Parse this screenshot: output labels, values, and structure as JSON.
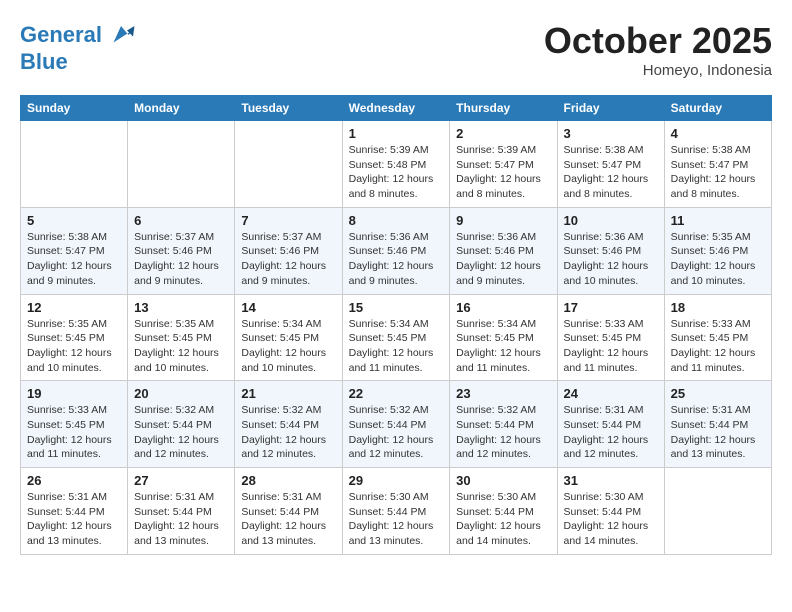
{
  "logo": {
    "line1": "General",
    "line2": "Blue"
  },
  "title": "October 2025",
  "subtitle": "Homeyo, Indonesia",
  "weekdays": [
    "Sunday",
    "Monday",
    "Tuesday",
    "Wednesday",
    "Thursday",
    "Friday",
    "Saturday"
  ],
  "weeks": [
    [
      {
        "day": "",
        "info": ""
      },
      {
        "day": "",
        "info": ""
      },
      {
        "day": "",
        "info": ""
      },
      {
        "day": "1",
        "info": "Sunrise: 5:39 AM\nSunset: 5:48 PM\nDaylight: 12 hours\nand 8 minutes."
      },
      {
        "day": "2",
        "info": "Sunrise: 5:39 AM\nSunset: 5:47 PM\nDaylight: 12 hours\nand 8 minutes."
      },
      {
        "day": "3",
        "info": "Sunrise: 5:38 AM\nSunset: 5:47 PM\nDaylight: 12 hours\nand 8 minutes."
      },
      {
        "day": "4",
        "info": "Sunrise: 5:38 AM\nSunset: 5:47 PM\nDaylight: 12 hours\nand 8 minutes."
      }
    ],
    [
      {
        "day": "5",
        "info": "Sunrise: 5:38 AM\nSunset: 5:47 PM\nDaylight: 12 hours\nand 9 minutes."
      },
      {
        "day": "6",
        "info": "Sunrise: 5:37 AM\nSunset: 5:46 PM\nDaylight: 12 hours\nand 9 minutes."
      },
      {
        "day": "7",
        "info": "Sunrise: 5:37 AM\nSunset: 5:46 PM\nDaylight: 12 hours\nand 9 minutes."
      },
      {
        "day": "8",
        "info": "Sunrise: 5:36 AM\nSunset: 5:46 PM\nDaylight: 12 hours\nand 9 minutes."
      },
      {
        "day": "9",
        "info": "Sunrise: 5:36 AM\nSunset: 5:46 PM\nDaylight: 12 hours\nand 9 minutes."
      },
      {
        "day": "10",
        "info": "Sunrise: 5:36 AM\nSunset: 5:46 PM\nDaylight: 12 hours\nand 10 minutes."
      },
      {
        "day": "11",
        "info": "Sunrise: 5:35 AM\nSunset: 5:46 PM\nDaylight: 12 hours\nand 10 minutes."
      }
    ],
    [
      {
        "day": "12",
        "info": "Sunrise: 5:35 AM\nSunset: 5:45 PM\nDaylight: 12 hours\nand 10 minutes."
      },
      {
        "day": "13",
        "info": "Sunrise: 5:35 AM\nSunset: 5:45 PM\nDaylight: 12 hours\nand 10 minutes."
      },
      {
        "day": "14",
        "info": "Sunrise: 5:34 AM\nSunset: 5:45 PM\nDaylight: 12 hours\nand 10 minutes."
      },
      {
        "day": "15",
        "info": "Sunrise: 5:34 AM\nSunset: 5:45 PM\nDaylight: 12 hours\nand 11 minutes."
      },
      {
        "day": "16",
        "info": "Sunrise: 5:34 AM\nSunset: 5:45 PM\nDaylight: 12 hours\nand 11 minutes."
      },
      {
        "day": "17",
        "info": "Sunrise: 5:33 AM\nSunset: 5:45 PM\nDaylight: 12 hours\nand 11 minutes."
      },
      {
        "day": "18",
        "info": "Sunrise: 5:33 AM\nSunset: 5:45 PM\nDaylight: 12 hours\nand 11 minutes."
      }
    ],
    [
      {
        "day": "19",
        "info": "Sunrise: 5:33 AM\nSunset: 5:45 PM\nDaylight: 12 hours\nand 11 minutes."
      },
      {
        "day": "20",
        "info": "Sunrise: 5:32 AM\nSunset: 5:44 PM\nDaylight: 12 hours\nand 12 minutes."
      },
      {
        "day": "21",
        "info": "Sunrise: 5:32 AM\nSunset: 5:44 PM\nDaylight: 12 hours\nand 12 minutes."
      },
      {
        "day": "22",
        "info": "Sunrise: 5:32 AM\nSunset: 5:44 PM\nDaylight: 12 hours\nand 12 minutes."
      },
      {
        "day": "23",
        "info": "Sunrise: 5:32 AM\nSunset: 5:44 PM\nDaylight: 12 hours\nand 12 minutes."
      },
      {
        "day": "24",
        "info": "Sunrise: 5:31 AM\nSunset: 5:44 PM\nDaylight: 12 hours\nand 12 minutes."
      },
      {
        "day": "25",
        "info": "Sunrise: 5:31 AM\nSunset: 5:44 PM\nDaylight: 12 hours\nand 13 minutes."
      }
    ],
    [
      {
        "day": "26",
        "info": "Sunrise: 5:31 AM\nSunset: 5:44 PM\nDaylight: 12 hours\nand 13 minutes."
      },
      {
        "day": "27",
        "info": "Sunrise: 5:31 AM\nSunset: 5:44 PM\nDaylight: 12 hours\nand 13 minutes."
      },
      {
        "day": "28",
        "info": "Sunrise: 5:31 AM\nSunset: 5:44 PM\nDaylight: 12 hours\nand 13 minutes."
      },
      {
        "day": "29",
        "info": "Sunrise: 5:30 AM\nSunset: 5:44 PM\nDaylight: 12 hours\nand 13 minutes."
      },
      {
        "day": "30",
        "info": "Sunrise: 5:30 AM\nSunset: 5:44 PM\nDaylight: 12 hours\nand 14 minutes."
      },
      {
        "day": "31",
        "info": "Sunrise: 5:30 AM\nSunset: 5:44 PM\nDaylight: 12 hours\nand 14 minutes."
      },
      {
        "day": "",
        "info": ""
      }
    ]
  ]
}
